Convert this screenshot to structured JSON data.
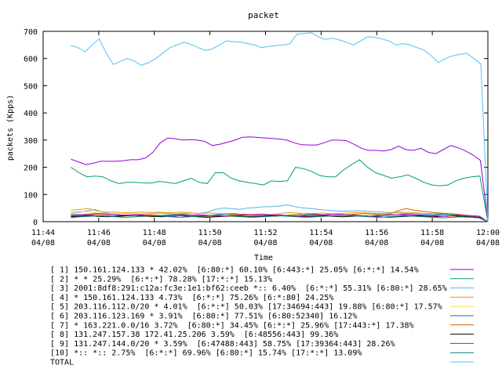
{
  "chart_data": {
    "type": "line",
    "title": "packet",
    "xlabel": "Time",
    "ylabel": "packets (Kpps)",
    "ylim": [
      0,
      700
    ],
    "yticks": [
      "0",
      "100",
      "200",
      "300",
      "400",
      "500",
      "600",
      "700"
    ],
    "xticks": [
      {
        "time": "11:44",
        "date": "04/08"
      },
      {
        "time": "11:46",
        "date": "04/08"
      },
      {
        "time": "11:48",
        "date": "04/08"
      },
      {
        "time": "11:50",
        "date": "04/08"
      },
      {
        "time": "11:52",
        "date": "04/08"
      },
      {
        "time": "11:54",
        "date": "04/08"
      },
      {
        "time": "11:56",
        "date": "04/08"
      },
      {
        "time": "11:58",
        "date": "04/08"
      },
      {
        "time": "12:00",
        "date": "04/08"
      }
    ],
    "x": [
      "11:45:00",
      "11:45:20",
      "11:45:40",
      "11:46:00",
      "11:46:20",
      "11:46:40",
      "11:47:00",
      "11:47:20",
      "11:47:40",
      "11:48:00",
      "11:48:20",
      "11:48:40",
      "11:49:00",
      "11:49:20",
      "11:49:40",
      "11:50:00",
      "11:50:20",
      "11:50:40",
      "11:51:00",
      "11:51:20",
      "11:51:40",
      "11:52:00",
      "11:52:20",
      "11:52:40",
      "11:53:00",
      "11:53:20",
      "11:53:40",
      "11:54:00",
      "11:54:20",
      "11:54:40",
      "11:55:00",
      "11:55:20",
      "11:55:40",
      "11:56:00",
      "11:56:20",
      "11:56:40",
      "11:57:00",
      "11:57:20",
      "11:57:40",
      "11:58:00",
      "11:58:20",
      "11:58:40",
      "11:59:00",
      "11:59:20",
      "11:59:40",
      "12:00:00"
    ],
    "series": [
      {
        "name": "[ 1] 150.161.124.133 * 42.02%  [6:80:*] 60.10% [6:443:*] 25.05% [6:*:*] 14.54%",
        "color": "#9400d3",
        "values": [
          230,
          220,
          210,
          215,
          222,
          222,
          222,
          224,
          228,
          228,
          234,
          255,
          290,
          308,
          305,
          300,
          302,
          300,
          295,
          280,
          285,
          292,
          300,
          310,
          312,
          310,
          308,
          306,
          304,
          300,
          290,
          283,
          282,
          282,
          290,
          300,
          300,
          298,
          285,
          270,
          262,
          262,
          260,
          265,
          278,
          265,
          262,
          270,
          255,
          250,
          265,
          280,
          272,
          260,
          245,
          225,
          0
        ]
      },
      {
        "name": "[ 2] * * 25.29%  [6:*:*] 78.28% [17:*:*] 15.13%",
        "color": "#009e73",
        "values": [
          200,
          180,
          165,
          168,
          165,
          150,
          140,
          145,
          145,
          143,
          142,
          148,
          145,
          140,
          150,
          160,
          145,
          140,
          180,
          180,
          160,
          150,
          145,
          140,
          135,
          150,
          148,
          150,
          200,
          195,
          185,
          170,
          165,
          165,
          190,
          210,
          228,
          200,
          180,
          170,
          160,
          165,
          172,
          160,
          145,
          135,
          132,
          135,
          150,
          160,
          165,
          168,
          0
        ]
      },
      {
        "name": "[ 3] 2001:8df8:291:c12a:fc3e:1e1:bf62:ceeb *:: 6.40%  [6:*:*] 55.31% [6:80:*] 28.65%",
        "color": "#56b4e9",
        "values": [
          30,
          35,
          40,
          45,
          35,
          30,
          28,
          30,
          30,
          28,
          30,
          32,
          30,
          28,
          30,
          32,
          30,
          35,
          45,
          50,
          48,
          45,
          50,
          52,
          55,
          55,
          58,
          62,
          55,
          50,
          48,
          45,
          42,
          40,
          38,
          40,
          40,
          38,
          36,
          35,
          34,
          32,
          30,
          30,
          28,
          25,
          24,
          22,
          22,
          20,
          22,
          20,
          0
        ]
      },
      {
        "name": "[ 4] * 150.161.124.133 4.73%  [6:*:*] 75.26% [6:*:80] 24.25%",
        "color": "#e69f00",
        "values": [
          42,
          45,
          48,
          40,
          35,
          35,
          33,
          34,
          35,
          34,
          35,
          33,
          34,
          35,
          32,
          30,
          32,
          30,
          28,
          25,
          24,
          22,
          24,
          25,
          30,
          33,
          32,
          28,
          30,
          32,
          28,
          30,
          32,
          34,
          32,
          30,
          30,
          33,
          35,
          34,
          32,
          30,
          30,
          28,
          25,
          24,
          22,
          20,
          0
        ]
      },
      {
        "name": "[ 5] 203.116.112.0/20 * 4.01%  [6:*:*] 50.03% [17:34694:443] 19.88% [6:80:*] 17.57%",
        "color": "#f0e442",
        "values": [
          35,
          38,
          36,
          32,
          30,
          30,
          28,
          30,
          28,
          26,
          25,
          25,
          26,
          25,
          24,
          22,
          22,
          20,
          18,
          18,
          20,
          22,
          24,
          22,
          20,
          22,
          24,
          25,
          22,
          20,
          20,
          22,
          22,
          24,
          25,
          24,
          22,
          20,
          22,
          24,
          22,
          20,
          18,
          20,
          18,
          16,
          0
        ]
      },
      {
        "name": "[ 6] 203.116.123.169 * 3.91%  [6:80:*] 77.51% [6:80:52340] 16.12%",
        "color": "#0072b2",
        "values": [
          25,
          26,
          24,
          22,
          20,
          22,
          24,
          25,
          22,
          20,
          22,
          25,
          28,
          25,
          24,
          22,
          25,
          28,
          30,
          25,
          24,
          22,
          24,
          25,
          22,
          22,
          25,
          26,
          24,
          22,
          24,
          25,
          22,
          20,
          24,
          25,
          26,
          24,
          22,
          24,
          25,
          28,
          26,
          24,
          22,
          20,
          0
        ]
      },
      {
        "name": "[ 7] * 163.221.0.0/16 3.72%  [6:80:*] 34.45% [6:*:*] 25.96% [17:443:*] 17.38%",
        "color": "#d55e00",
        "values": [
          20,
          22,
          24,
          28,
          25,
          22,
          20,
          22,
          24,
          20,
          18,
          20,
          22,
          24,
          25,
          22,
          20,
          18,
          20,
          22,
          25,
          28,
          26,
          24,
          22,
          20,
          22,
          25,
          28,
          30,
          28,
          25,
          22,
          24,
          26,
          28,
          30,
          28,
          25,
          28,
          40,
          48,
          42,
          38,
          35,
          32,
          30,
          28,
          25,
          22,
          20,
          0
        ]
      },
      {
        "name": "[ 8] 131.247.157.38 172.41.25.206 3.59%  [6:48556:443] 99.36%",
        "color": "#000000",
        "values": [
          18,
          20,
          22,
          20,
          18,
          20,
          22,
          24,
          22,
          20,
          18,
          20,
          22,
          20,
          18,
          16,
          18,
          20,
          22,
          20,
          18,
          20,
          22,
          24,
          22,
          20,
          18,
          20,
          22,
          20,
          18,
          20,
          22,
          20,
          18,
          16,
          18,
          20,
          22,
          20,
          18,
          20,
          22,
          20,
          18,
          16,
          0
        ]
      },
      {
        "name": "[ 9] 131.247.144.0/20 * 3.59%  [6:47488:443] 58.75% [17:39364:443] 28.26%",
        "color": "#cc00cc",
        "values": [
          22,
          25,
          28,
          30,
          28,
          26,
          24,
          25,
          26,
          24,
          22,
          20,
          22,
          24,
          25,
          24,
          22,
          20,
          22,
          24,
          26,
          28,
          26,
          24,
          22,
          20,
          22,
          24,
          26,
          28,
          26,
          24,
          22,
          20,
          22,
          24,
          26,
          28,
          26,
          24,
          22,
          20,
          22,
          24,
          22,
          20,
          0
        ]
      },
      {
        "name": "[10] *:: *:: 2.75%  [6:*:*] 69.96% [6:80:*] 15.74% [17:*:*] 13.09%",
        "color": "#008080",
        "values": [
          15,
          18,
          20,
          22,
          20,
          18,
          16,
          18,
          20,
          22,
          20,
          18,
          16,
          18,
          20,
          22,
          24,
          22,
          20,
          18,
          16,
          18,
          20,
          22,
          20,
          18,
          16,
          18,
          20,
          22,
          24,
          22,
          20,
          18,
          16,
          18,
          20,
          22,
          20,
          18,
          16,
          14,
          16,
          18,
          16,
          14,
          0
        ]
      },
      {
        "name": "TOTAL",
        "color": "#4fc3f7",
        "values": [
          648,
          640,
          625,
          650,
          672,
          620,
          578,
          590,
          600,
          590,
          575,
          585,
          600,
          620,
          640,
          650,
          660,
          652,
          640,
          630,
          635,
          650,
          665,
          662,
          660,
          655,
          650,
          640,
          645,
          648,
          650,
          655,
          690,
          692,
          695,
          680,
          670,
          675,
          668,
          660,
          650,
          665,
          680,
          678,
          672,
          665,
          650,
          655,
          650,
          640,
          630,
          610,
          585,
          600,
          610,
          615,
          620,
          600,
          580,
          0
        ]
      }
    ]
  }
}
